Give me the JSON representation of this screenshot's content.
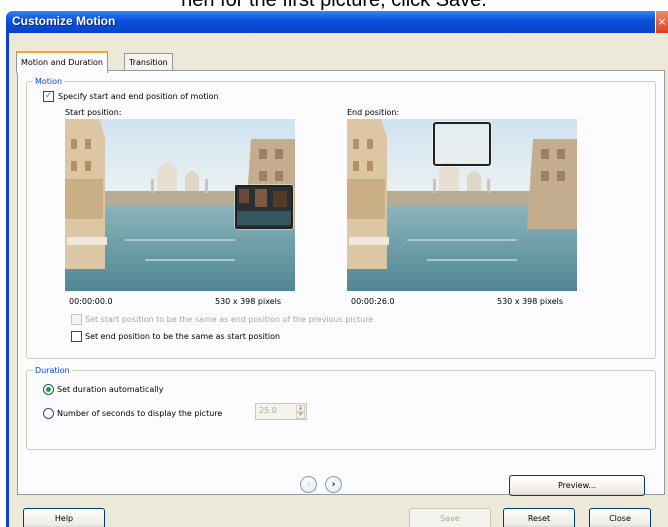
{
  "caption": "hen for the first picture, click Save.",
  "window": {
    "title": "Customize Motion",
    "close_glyph": "×"
  },
  "tabs": [
    {
      "label": "Motion and Duration",
      "active": true
    },
    {
      "label": "Transition",
      "active": false
    }
  ],
  "motion": {
    "legend": "Motion",
    "specify_label": "Specify start and end position of motion",
    "specify_checked": true,
    "start": {
      "label": "Start position:",
      "time": "00:00:00.0",
      "size": "530 x 398 pixels"
    },
    "end": {
      "label": "End position:",
      "time": "00:00:26.0",
      "size": "530 x 398 pixels"
    },
    "same_as_previous_label": "Set start position to be the same as end position of the previous picture",
    "same_as_previous_enabled": false,
    "same_as_start_label": "Set end position to be the same as start position",
    "same_as_start_checked": false
  },
  "duration": {
    "legend": "Duration",
    "auto_label": "Set duration automatically",
    "seconds_label": "Number of seconds to display the picture",
    "seconds_value": "25.0",
    "selected": "auto"
  },
  "nav": {
    "prev_glyph": "‹",
    "next_glyph": "›"
  },
  "buttons": {
    "preview": "Preview...",
    "help": "Help",
    "save": "Save",
    "reset": "Reset",
    "close": "Close"
  },
  "colors": {
    "title_bar": "#0a52dc",
    "dialog_bg": "#ece9d8",
    "legend_text": "#0046d5"
  }
}
